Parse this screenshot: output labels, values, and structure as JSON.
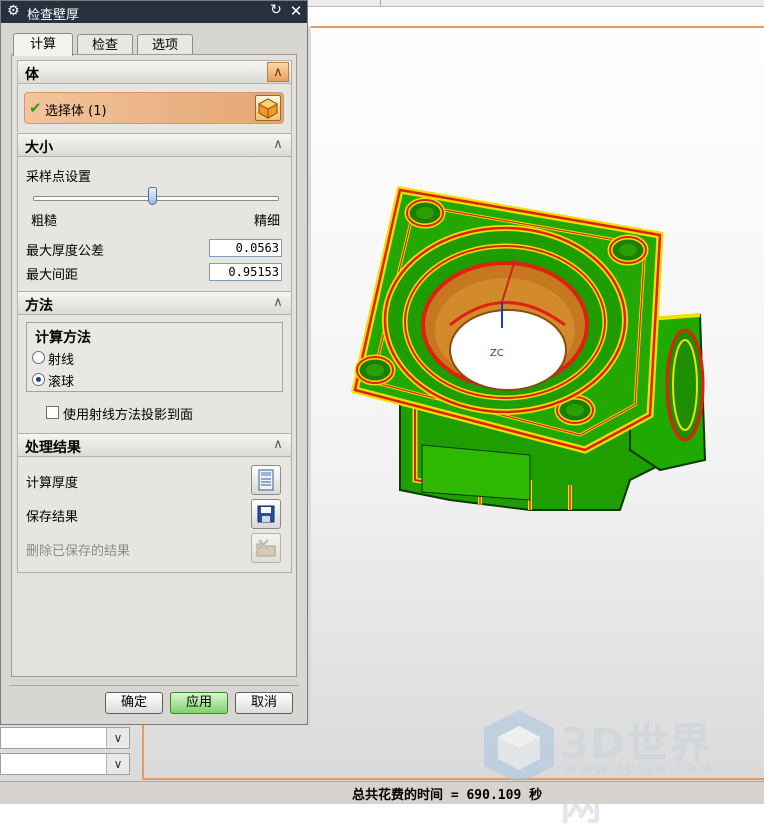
{
  "dialog": {
    "title": "检查壁厚",
    "tabs": [
      {
        "label": "计算",
        "active": true
      },
      {
        "label": "检查",
        "active": false
      },
      {
        "label": "选项",
        "active": false
      }
    ],
    "body_section": {
      "header": "体",
      "select_label": "选择体 (1)"
    },
    "size_section": {
      "header": "大小",
      "sample_label": "采样点设置",
      "slider_level_percent": 50,
      "slider_min_label": "粗糙",
      "slider_max_label": "精细",
      "max_thickness_tol_label": "最大厚度公差",
      "max_thickness_tol_value": "0.0563",
      "max_spacing_label": "最大间距",
      "max_spacing_value": "0.95153"
    },
    "method_section": {
      "header": "方法",
      "group_title": "计算方法",
      "options": [
        {
          "label": "射线",
          "selected": false
        },
        {
          "label": "滚球",
          "selected": true
        }
      ],
      "project_checkbox_label": "使用射线方法投影到面",
      "project_checked": false
    },
    "results_section": {
      "header": "处理结果",
      "compute_label": "计算厚度",
      "save_label": "保存结果",
      "delete_label": "删除已保存的结果"
    },
    "buttons": {
      "ok": "确定",
      "apply": "应用",
      "cancel": "取消"
    }
  },
  "viewport": {
    "axis_label": "ZC"
  },
  "status_bar": {
    "text": "总共花费的时间 = 690.109 秒"
  },
  "watermark": {
    "brand": "3D世界网",
    "url": "WWW.3DSJW.COM"
  },
  "colors": {
    "title_bar": "#25313f",
    "model_green": "#1faa00",
    "model_red": "#e02010",
    "model_yellow": "#f0e000",
    "accent_orange": "#e8a05a"
  }
}
